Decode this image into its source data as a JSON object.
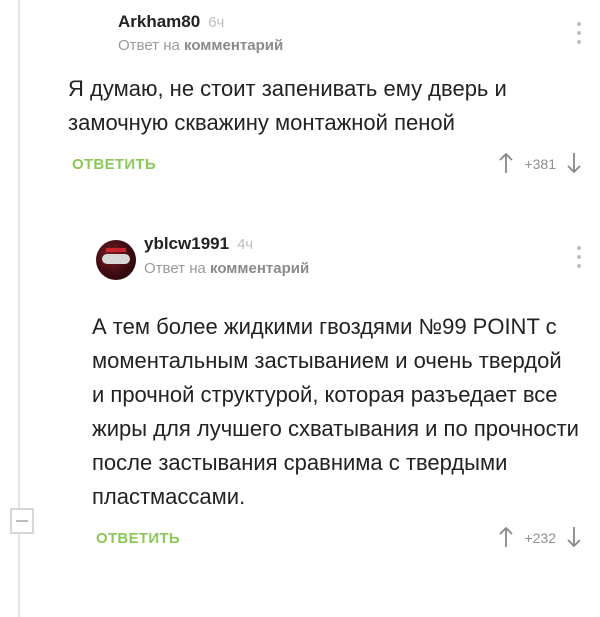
{
  "comments": [
    {
      "username": "Arkham80",
      "time": "6ч",
      "reply_prefix": "Ответ на",
      "reply_link": "комментарий",
      "body": "Я думаю, не стоит запенивать ему дверь и замочную скважину монтажной пеной",
      "reply_label": "ОТВЕТИТЬ",
      "rating": "+381"
    },
    {
      "username": "yblcw1991",
      "time": "4ч",
      "reply_prefix": "Ответ на",
      "reply_link": "комментарий",
      "body": "А тем более жидкими гвоздями №99 POINT с моментальным застыванием и очень твердой и прочной структурой, которая разъедает все жиры для лучшего схватывания и по прочности после застывания сравнима с твердыми пластмассами.",
      "reply_label": "ОТВЕТИТЬ",
      "rating": "+232"
    }
  ],
  "colors": {
    "reply": "#8ac858",
    "meta": "#9a9a9a"
  },
  "icons": [
    "more-vertical-icon",
    "arrow-up-icon",
    "arrow-down-icon",
    "collapse-minus-icon"
  ]
}
